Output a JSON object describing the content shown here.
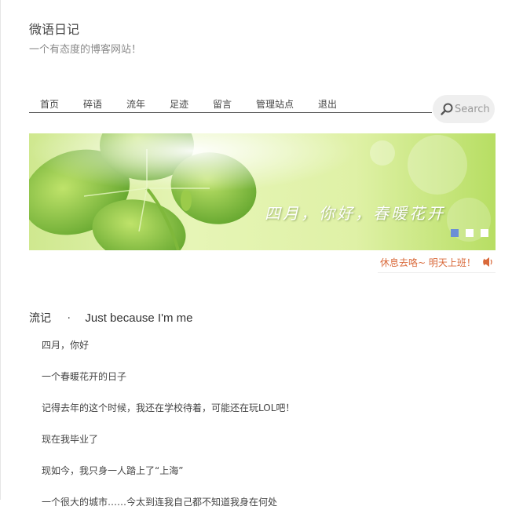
{
  "site": {
    "title": "微语日记",
    "tagline": "一个有态度的博客网站！"
  },
  "nav": {
    "items": [
      {
        "label": "首页"
      },
      {
        "label": "碎语"
      },
      {
        "label": "流年"
      },
      {
        "label": "足迹"
      },
      {
        "label": "留言"
      },
      {
        "label": "管理站点"
      },
      {
        "label": "退出"
      }
    ]
  },
  "search": {
    "placeholder": "Search",
    "icon": "magnifier-icon"
  },
  "banner": {
    "caption": "四月，你好，春暖花开",
    "slide_count": 3,
    "active_slide": 1,
    "colors": {
      "active_dot": "#6b8fd6",
      "inactive_dot": "#ffffff"
    }
  },
  "ticker": {
    "text": "休息去咯~ 明天上班！",
    "icon": "speaker-icon",
    "color": "#d9693a"
  },
  "post": {
    "category": "流记",
    "separator": "·",
    "title": "Just because I'm me",
    "lines": [
      "四月，你好",
      "一个春暖花开的日子",
      "记得去年的这个时候，我还在学校待着，可能还在玩LOL吧！",
      "现在我毕业了",
      "现如今，我只身一人踏上了“上海”",
      "一个很大的城市……今太到连我自己都不知道我身在何处"
    ]
  }
}
